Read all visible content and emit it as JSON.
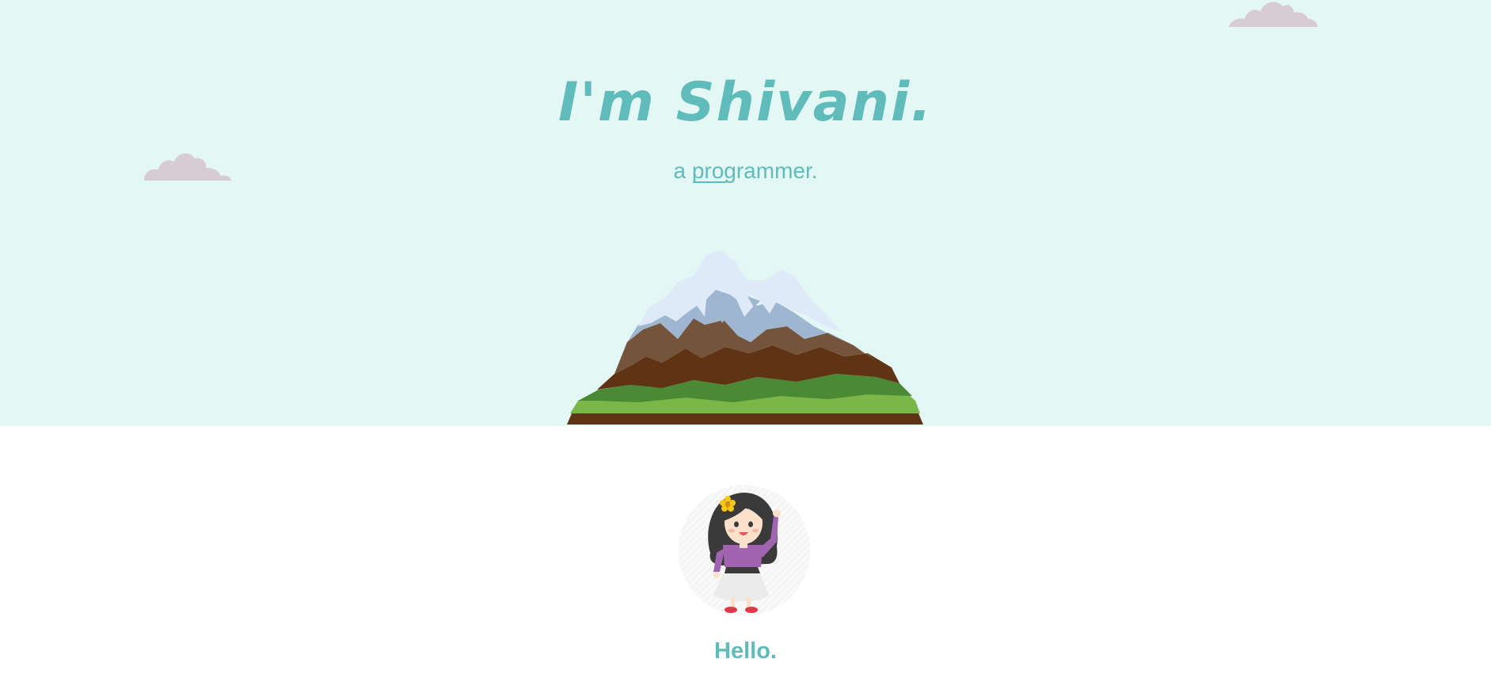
{
  "hero": {
    "title": "I'm Shivani.",
    "subtitle_prefix": "a ",
    "subtitle_role": "programmer.",
    "background": "#e3f7f4"
  },
  "about": {
    "greeting": "Hello."
  },
  "colors": {
    "accent": "#5fbcbb",
    "cloud": "#d9cbd2",
    "snow": "#deeaf8",
    "rock": "#74543a",
    "soil": "#5e3414",
    "grass": "#7ab648"
  },
  "icons": {
    "cloud_left": "cloud-icon",
    "cloud_right": "cloud-icon",
    "mountain": "mountain-illustration",
    "avatar": "girl-waving-avatar"
  }
}
